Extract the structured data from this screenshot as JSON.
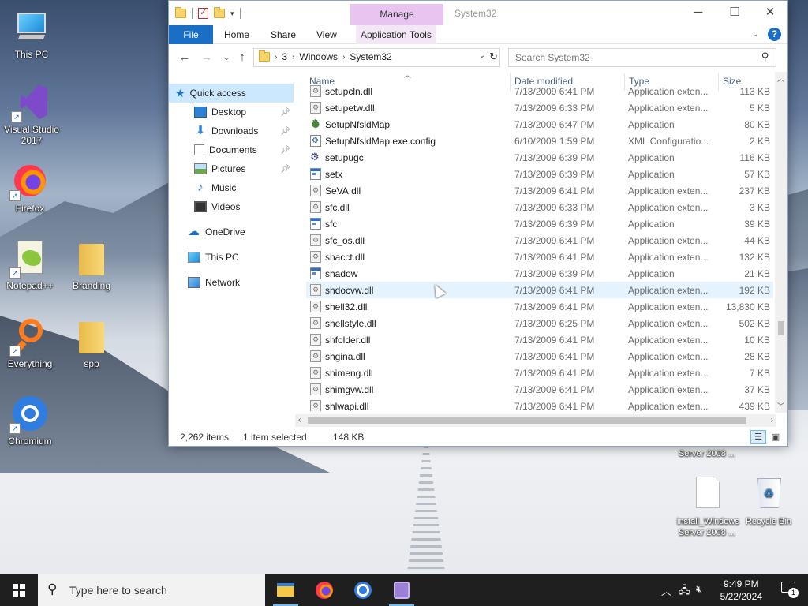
{
  "desktop": {
    "icons": [
      {
        "label": "This PC"
      },
      {
        "label": "Visual Studio 2017"
      },
      {
        "label": "Firefox"
      },
      {
        "label": "Notepad++"
      },
      {
        "label": "Branding"
      },
      {
        "label": "Everything"
      },
      {
        "label": "spp"
      },
      {
        "label": "Chromium"
      },
      {
        "label": "install_Windows Server 2008 ..."
      },
      {
        "label": "Recycle Bin"
      },
      {
        "label": "Server 2008 ..."
      }
    ]
  },
  "window": {
    "title": "System32",
    "manage_tab": "Manage",
    "ribbon_tabs": [
      "File",
      "Home",
      "Share",
      "View",
      "Application Tools"
    ],
    "address": {
      "crumbs": [
        "3",
        "Windows",
        "System32"
      ]
    },
    "search": {
      "placeholder": "Search System32"
    },
    "nav": {
      "items": [
        {
          "label": "Quick access",
          "selected": true
        },
        {
          "label": "Desktop",
          "pinned": true
        },
        {
          "label": "Downloads",
          "pinned": true
        },
        {
          "label": "Documents",
          "pinned": true
        },
        {
          "label": "Pictures",
          "pinned": true
        },
        {
          "label": "Music"
        },
        {
          "label": "Videos"
        },
        {
          "label": "OneDrive"
        },
        {
          "label": "This PC"
        },
        {
          "label": "Network"
        }
      ]
    },
    "columns": {
      "name": "Name",
      "date": "Date modified",
      "type": "Type",
      "size": "Size"
    },
    "files": [
      {
        "name": "setupcln.dll",
        "date": "7/13/2009 6:41 PM",
        "type": "Application exten...",
        "size": "113 KB",
        "icon": "dll-icon"
      },
      {
        "name": "setupetw.dll",
        "date": "7/13/2009 6:33 PM",
        "type": "Application exten...",
        "size": "5 KB",
        "icon": "dll-icon"
      },
      {
        "name": "SetupNfsldMap",
        "date": "7/13/2009 6:47 PM",
        "type": "Application",
        "size": "80 KB",
        "icon": "setup-app-icon"
      },
      {
        "name": "SetupNfsldMap.exe.config",
        "date": "6/10/2009 1:59 PM",
        "type": "XML Configuratio...",
        "size": "2 KB",
        "icon": "config-file-icon"
      },
      {
        "name": "setupugc",
        "date": "7/13/2009 6:39 PM",
        "type": "Application",
        "size": "116 KB",
        "icon": "setup-ugc-icon"
      },
      {
        "name": "setx",
        "date": "7/13/2009 6:39 PM",
        "type": "Application",
        "size": "57 KB",
        "icon": "app-icon"
      },
      {
        "name": "SeVA.dll",
        "date": "7/13/2009 6:41 PM",
        "type": "Application exten...",
        "size": "237 KB",
        "icon": "dll-icon"
      },
      {
        "name": "sfc.dll",
        "date": "7/13/2009 6:33 PM",
        "type": "Application exten...",
        "size": "3 KB",
        "icon": "dll-icon"
      },
      {
        "name": "sfc",
        "date": "7/13/2009 6:39 PM",
        "type": "Application",
        "size": "39 KB",
        "icon": "app-icon"
      },
      {
        "name": "sfc_os.dll",
        "date": "7/13/2009 6:41 PM",
        "type": "Application exten...",
        "size": "44 KB",
        "icon": "dll-icon"
      },
      {
        "name": "shacct.dll",
        "date": "7/13/2009 6:41 PM",
        "type": "Application exten...",
        "size": "132 KB",
        "icon": "dll-icon"
      },
      {
        "name": "shadow",
        "date": "7/13/2009 6:39 PM",
        "type": "Application",
        "size": "21 KB",
        "icon": "app-icon"
      },
      {
        "name": "shdocvw.dll",
        "date": "7/13/2009 6:41 PM",
        "type": "Application exten...",
        "size": "192 KB",
        "icon": "dll-icon",
        "hover": true
      },
      {
        "name": "shell32.dll",
        "date": "7/13/2009 6:41 PM",
        "type": "Application exten...",
        "size": "13,830 KB",
        "icon": "dll-icon"
      },
      {
        "name": "shellstyle.dll",
        "date": "7/13/2009 6:25 PM",
        "type": "Application exten...",
        "size": "502 KB",
        "icon": "dll-icon"
      },
      {
        "name": "shfolder.dll",
        "date": "7/13/2009 6:41 PM",
        "type": "Application exten...",
        "size": "10 KB",
        "icon": "dll-icon"
      },
      {
        "name": "shgina.dll",
        "date": "7/13/2009 6:41 PM",
        "type": "Application exten...",
        "size": "28 KB",
        "icon": "dll-icon"
      },
      {
        "name": "shimeng.dll",
        "date": "7/13/2009 6:41 PM",
        "type": "Application exten...",
        "size": "7 KB",
        "icon": "dll-icon"
      },
      {
        "name": "shimgvw.dll",
        "date": "7/13/2009 6:41 PM",
        "type": "Application exten...",
        "size": "37 KB",
        "icon": "dll-icon"
      },
      {
        "name": "shlwapi.dll",
        "date": "7/13/2009 6:41 PM",
        "type": "Application exten...",
        "size": "439 KB",
        "icon": "dll-icon"
      }
    ],
    "status": {
      "count": "2,262 items",
      "selected": "1 item selected",
      "size": "148 KB"
    }
  },
  "taskbar": {
    "search_placeholder": "Type here to search",
    "clock": {
      "time": "9:49 PM",
      "date": "5/22/2024"
    },
    "notification_count": "1"
  },
  "colors": {
    "accent": "#1a6fc4",
    "manage_tab": "#e8c5f0",
    "selection": "#cce8ff",
    "taskbar": "#1f1f1f"
  }
}
